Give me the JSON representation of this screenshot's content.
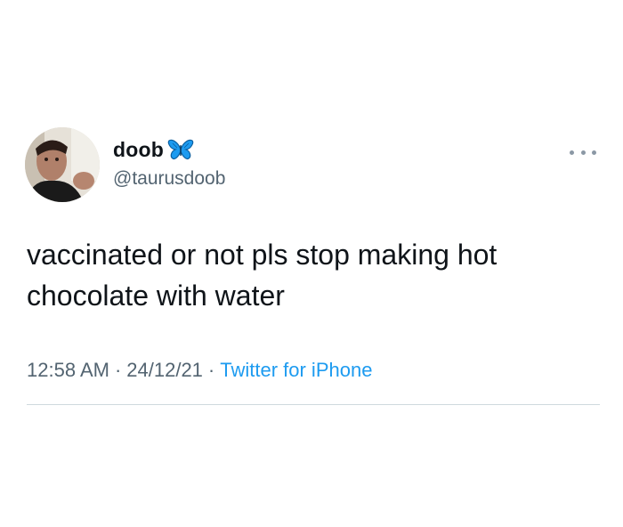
{
  "author": {
    "display_name": "doob",
    "handle": "@taurusdoob",
    "badge_icon": "butterfly-icon",
    "badge_color": "#1d9bf0"
  },
  "tweet": {
    "text": "vaccinated or not pls stop making hot chocolate with water"
  },
  "meta": {
    "time": "12:58 AM",
    "separator": "·",
    "date": "24/12/21",
    "source": "Twitter for iPhone"
  },
  "menu": {
    "icon": "more-options-icon"
  },
  "colors": {
    "text_primary": "#0f1419",
    "text_secondary": "#536471",
    "link": "#1d9bf0",
    "divider": "#cfd9de"
  }
}
